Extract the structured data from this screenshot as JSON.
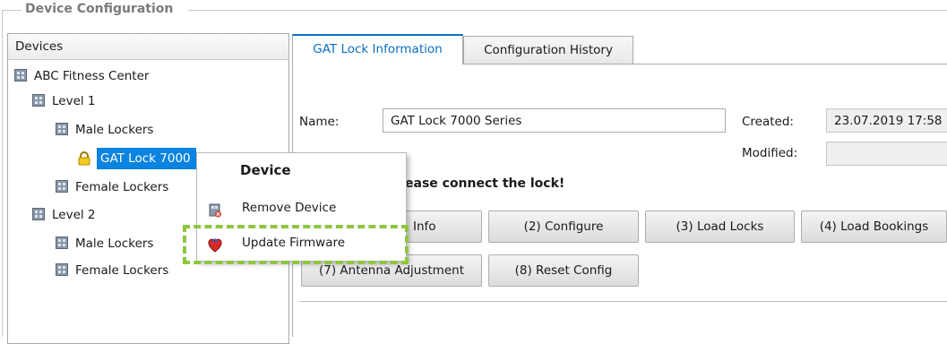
{
  "group": {
    "title": "Device Configuration"
  },
  "devices": {
    "header": "Devices",
    "tree": [
      {
        "label": "ABC Fitness Center",
        "icon": "building-icon",
        "selected": false
      },
      {
        "label": "Level 1",
        "icon": "building-icon",
        "selected": false
      },
      {
        "label": "Male Lockers",
        "icon": "building-icon",
        "selected": false
      },
      {
        "label": "GAT Lock 7000",
        "icon": "lock-icon",
        "selected": true
      },
      {
        "label": "Female Lockers",
        "icon": "building-icon",
        "selected": false
      },
      {
        "label": "Level 2",
        "icon": "building-icon",
        "selected": false
      },
      {
        "label": "Male Lockers",
        "icon": "building-icon",
        "selected": false
      },
      {
        "label": "Female Lockers",
        "icon": "building-icon",
        "selected": false
      }
    ]
  },
  "tabs": [
    {
      "label": "GAT Lock Information",
      "active": true
    },
    {
      "label": "Configuration History",
      "active": false
    }
  ],
  "info": {
    "name_label": "Name:",
    "name_value": "GAT Lock 7000 Series",
    "created_label": "Created:",
    "created_value": "23.07.2019 17:58",
    "modified_label": "Modified:",
    "modified_value": "",
    "message": "ease connect the lock!"
  },
  "buttons": {
    "info": "Info",
    "configure": "(2) Configure",
    "load_locks": "(3) Load Locks",
    "load_bookings": "(4) Load Bookings",
    "antenna": "(7) Antenna Adjustment",
    "reset": "(8) Reset Config"
  },
  "context_menu": {
    "title": "Device",
    "items": [
      {
        "label": "Remove Device",
        "icon": "remove-device-icon"
      },
      {
        "label": "Update Firmware",
        "icon": "firmware-icon"
      }
    ]
  },
  "colors": {
    "accent": "#0a6fc2",
    "selection": "#0b83e0",
    "highlight": "#8dc63f"
  }
}
